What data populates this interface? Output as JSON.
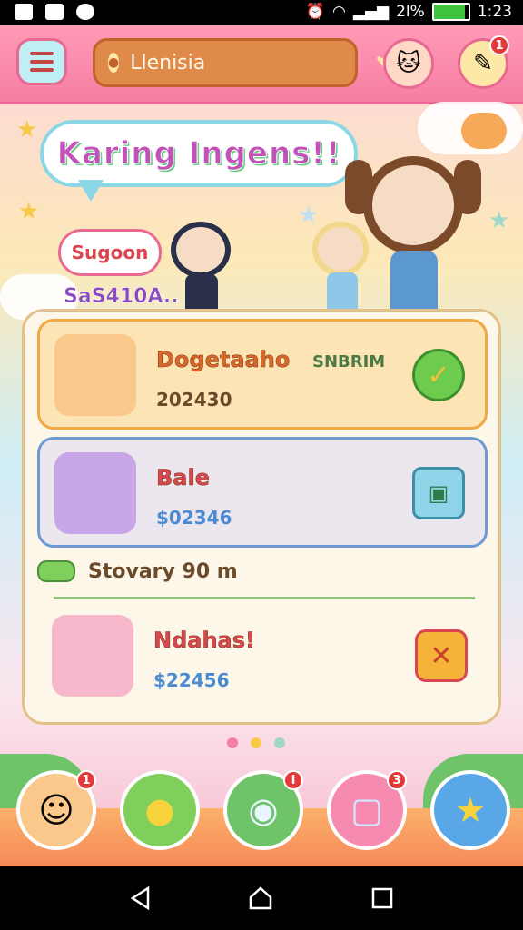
{
  "status_bar": {
    "battery_text": "2l%",
    "time": "1:23",
    "battery_level": 0.9,
    "icons": [
      "image-icon",
      "download-icon",
      "alarm-icon",
      "wifi-icon",
      "signal-icon",
      "battery-icon"
    ]
  },
  "header": {
    "search_value": "Llenisia",
    "notification_count": "1"
  },
  "hero": {
    "title": "Karing Ingens!!",
    "bubble_text": "Sugoon",
    "subtitle": "SaS410A.."
  },
  "list": {
    "items": [
      {
        "name": "Dogetaaho",
        "tag": "SNBRIM",
        "value": "202430"
      },
      {
        "name": "Bale",
        "value": "$02346"
      }
    ],
    "divider_label": "Stovary 90 m",
    "item3": {
      "name": "Ndahas!",
      "value": "$22456"
    }
  },
  "dock": {
    "badges": [
      "1",
      "I",
      "3"
    ]
  },
  "colors": {
    "accent": "#f67ea3",
    "success": "#6dcc4e",
    "warning": "#f6b33a",
    "link": "#4c8bd2"
  }
}
